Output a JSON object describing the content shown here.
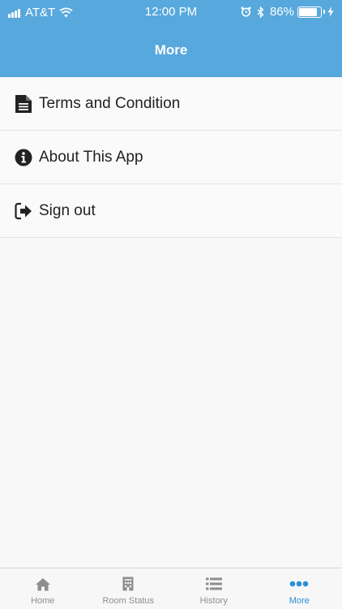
{
  "status_bar": {
    "carrier": "AT&T",
    "time": "12:00 PM",
    "battery": "86%",
    "battery_level": 0.86
  },
  "header": {
    "title": "More"
  },
  "menu": {
    "items": [
      {
        "label": "Terms and Condition",
        "icon": "document-icon"
      },
      {
        "label": "About This App",
        "icon": "info-icon"
      },
      {
        "label": "Sign out",
        "icon": "sign-out-icon"
      }
    ]
  },
  "tabbar": {
    "tabs": [
      {
        "label": "Home",
        "icon": "home-icon",
        "active": false
      },
      {
        "label": "Room Status",
        "icon": "building-icon",
        "active": false
      },
      {
        "label": "History",
        "icon": "list-icon",
        "active": false
      },
      {
        "label": "More",
        "icon": "more-icon",
        "active": true
      }
    ]
  },
  "colors": {
    "header": "#57a8dc",
    "active_tab": "#2a8fd6",
    "inactive_tab": "#8e8e8e"
  }
}
